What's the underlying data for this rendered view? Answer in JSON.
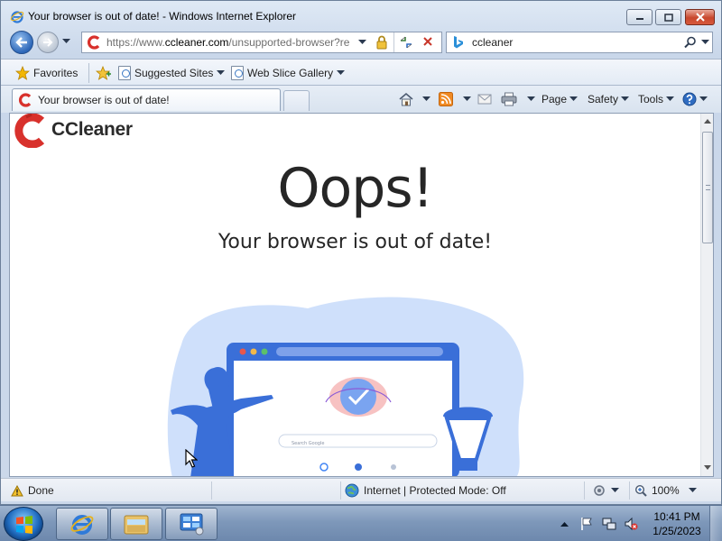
{
  "window": {
    "title": "Your browser is out of date! - Windows Internet Explorer"
  },
  "address": {
    "url_prefix": "https://www.",
    "url_host": "ccleaner.com",
    "url_rest": "/unsupported-browser?re",
    "search_text": "ccleaner"
  },
  "favorites_bar": {
    "favorites_label": "Favorites",
    "suggested_sites_label": "Suggested Sites",
    "web_slice_gallery_label": "Web Slice Gallery"
  },
  "tab": {
    "label": "Your browser is out of date!"
  },
  "command_bar": {
    "page_label": "Page",
    "safety_label": "Safety",
    "tools_label": "Tools"
  },
  "page": {
    "logo_text": "CCleaner",
    "heading": "Oops!",
    "subheading": "Your browser is out of date!",
    "illustration_search_placeholder": "Search Google"
  },
  "status_bar": {
    "status_text": "Done",
    "zone_text": "Internet | Protected Mode: Off",
    "zoom_text": "100%"
  },
  "taskbar": {
    "time": "10:41 PM",
    "date": "1/25/2023"
  },
  "colors": {
    "window_frame": "#c9d7ea",
    "ccleaner_red": "#d8312c",
    "illustration_blue": "#3a6fd8",
    "illustration_light_blue": "#cfe0fb"
  }
}
